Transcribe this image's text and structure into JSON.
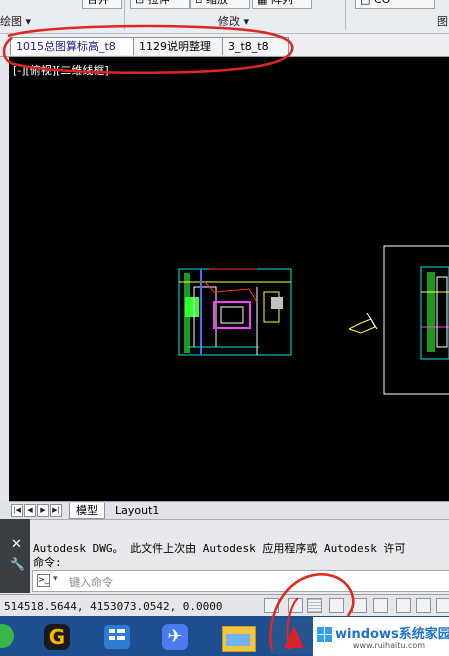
{
  "ribbon": {
    "top_left_btn": "合并",
    "stretch_label": "拉伸",
    "scale_label": "缩放",
    "array_label": "阵列",
    "panel_draw": "绘图 ▾",
    "panel_modify": "修改 ▾",
    "panel_right": "图"
  },
  "tabs": [
    {
      "label": "1015总图算标高_t8",
      "active": true
    },
    {
      "label": "1129说明整理",
      "active": false
    },
    {
      "label": "3_t8_t8",
      "active": false
    }
  ],
  "viewport": {
    "label": "[-][俯视][二维线框]"
  },
  "layout_tabs": [
    {
      "label": "模型",
      "active": true
    },
    {
      "label": "Layout1",
      "active": false
    }
  ],
  "command": {
    "line1": "Autodesk DWG。  此文件上次由 Autodesk 应用程序或 Autodesk 许可",
    "line2": "命令:",
    "placeholder": "键入命令"
  },
  "status": {
    "coordinates": "514518.5644, 4153073.0542, 0.0000"
  },
  "taskbar": {
    "apps": [
      "start-app-icon",
      "browser-icon",
      "apps-icon",
      "bird-app-icon",
      "file-explorer-icon",
      "autocad-icon"
    ]
  },
  "watermark": {
    "brand": "windows系统家园",
    "url": "www.ruihaitu.com"
  },
  "colors": {
    "annotation_red": "#e0261f",
    "canvas_bg": "#000000",
    "taskbar_bg": "#1d4e8f",
    "active_tab_text": "#1c1c8c"
  }
}
